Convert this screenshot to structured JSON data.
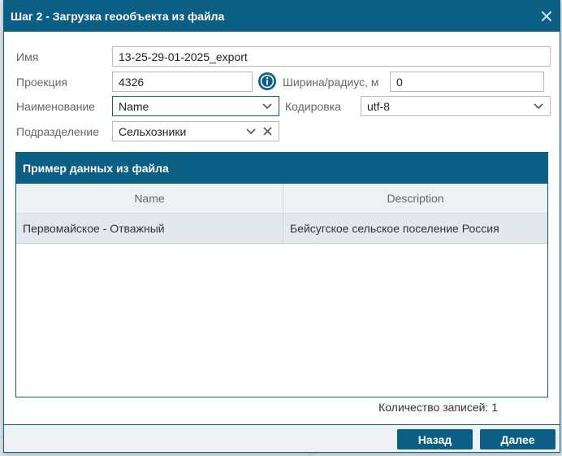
{
  "dialog": {
    "title": "Шаг 2 - Загрузка геообъекта из файла"
  },
  "form": {
    "name_label": "Имя",
    "name_value": "13-25-29-01-2025_export",
    "projection_label": "Проекция",
    "projection_value": "4326",
    "width_label": "Ширина/радиус, м",
    "width_value": "0",
    "naming_label": "Наименование",
    "naming_value": "Name",
    "encoding_label": "Кодировка",
    "encoding_value": "utf-8",
    "division_label": "Подразделение",
    "division_value": "Сельхозники"
  },
  "grid": {
    "title": "Пример данных из файла",
    "columns": [
      "Name",
      "Description"
    ],
    "rows": [
      [
        "Первомайское - Отважный",
        "Бейсугское сельское поселение Россия"
      ]
    ],
    "count_text": "Количество записей: 1"
  },
  "footer": {
    "back_label": "Назад",
    "next_label": "Далее"
  },
  "colors": {
    "accent": "#0b5f84",
    "row_bg": "#e3e8ee",
    "header_bg": "#edf1f4"
  },
  "icons": {
    "close": "close-icon",
    "info": "info-icon",
    "chevron": "chevron-down-icon",
    "clear": "clear-icon"
  }
}
